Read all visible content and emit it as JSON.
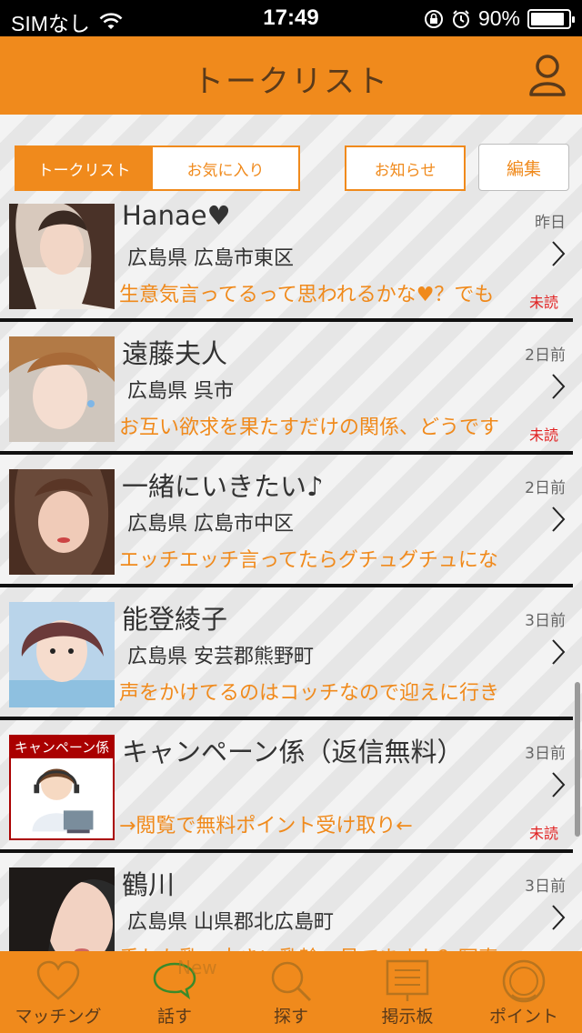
{
  "status_bar": {
    "carrier": "SIMなし",
    "time": "17:49",
    "battery": "90%",
    "battery_level": 0.9
  },
  "header": {
    "title": "トークリスト"
  },
  "tabs": {
    "talk_list": "トークリスト",
    "favorites": "お気に入り",
    "notice": "お知らせ",
    "edit": "編集"
  },
  "conversations": [
    {
      "name": "Hanae♥",
      "time": "昨日",
      "location": "広島県 広島市東区",
      "message": "生意気言ってるって思われるかな♥？でも",
      "unread": "未読"
    },
    {
      "name": "遠藤夫人",
      "time": "2日前",
      "location": "広島県 呉市",
      "message": "お互い欲求を果たすだけの関係、どうです",
      "unread": "未読"
    },
    {
      "name": "一緒にいきたい♪",
      "time": "2日前",
      "location": "広島県 広島市中区",
      "message": "エッチエッチ言ってたらグチュグチュにな",
      "unread": ""
    },
    {
      "name": "能登綾子",
      "time": "3日前",
      "location": "広島県 安芸郡熊野町",
      "message": "声をかけてるのはコッチなので迎えに行き",
      "unread": ""
    },
    {
      "name": "キャンペーン係（返信無料）",
      "time": "3日前",
      "location": "",
      "message": "→閲覧で無料ポイント受け取り←",
      "unread": "未読",
      "badge": "キャンペーン係"
    },
    {
      "name": "鶴川",
      "time": "3日前",
      "location": "広島県 山県郡北広島町",
      "message": "垂れた乳、大きい乳輪、見てますか？写真",
      "unread": ""
    }
  ],
  "tab_bar": {
    "items": [
      {
        "label": "マッチング",
        "icon": "heart-icon"
      },
      {
        "label": "話す",
        "icon": "speech-bubble-icon"
      },
      {
        "label": "探す",
        "icon": "search-icon"
      },
      {
        "label": "掲示板",
        "icon": "board-icon"
      },
      {
        "label": "ポイント",
        "icon": "coin-icon"
      }
    ],
    "new_badge": "New"
  },
  "colors": {
    "accent": "#f08a1c",
    "header_text": "#5a3a1a",
    "unread": "#e02020"
  }
}
